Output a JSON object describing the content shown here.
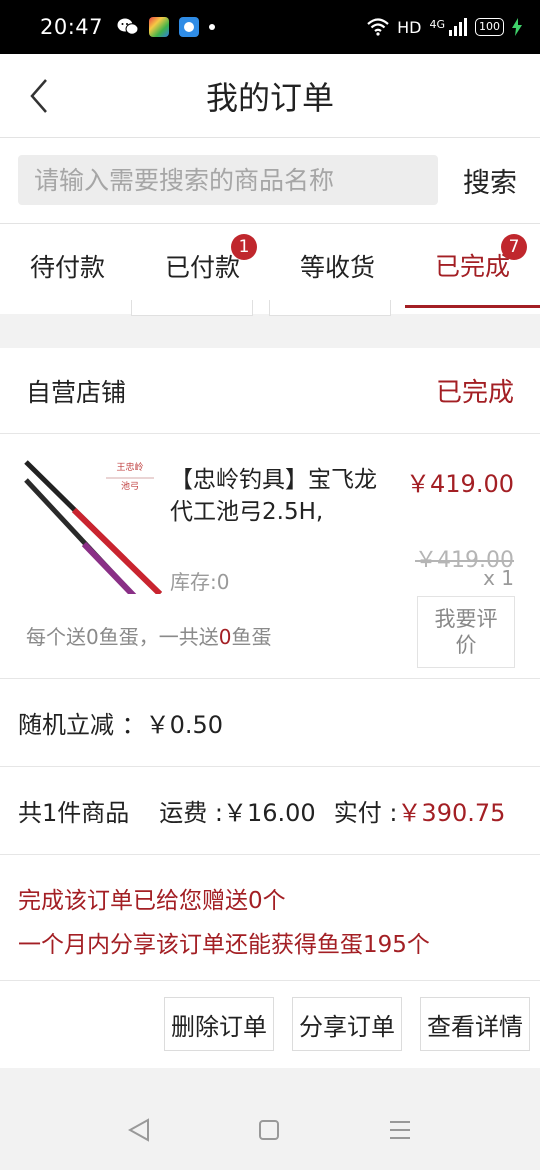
{
  "status_bar": {
    "time": "20:47",
    "network": "HD",
    "signal": "4G",
    "battery": "100"
  },
  "header": {
    "title": "我的订单"
  },
  "search": {
    "placeholder": "请输入需要搜索的商品名称",
    "button_label": "搜索"
  },
  "tabs": [
    {
      "label": "待付款",
      "badge": ""
    },
    {
      "label": "已付款",
      "badge": "1"
    },
    {
      "label": "等收货",
      "badge": ""
    },
    {
      "label": "已完成",
      "badge": "7",
      "active": true
    }
  ],
  "order": {
    "shop_name": "自营店铺",
    "status": "已完成",
    "product": {
      "name": "【忠岭钓具】宝飞龙代工池弓2.5H,",
      "price": "￥419.00",
      "original_price": "￥419.00",
      "stock": "库存:0",
      "quantity": "x 1",
      "thumb_text_1": "王忠岭",
      "thumb_text_2": "池弓"
    },
    "gift_prefix": "每个送0鱼蛋，一共送",
    "gift_count": "0",
    "gift_suffix": "鱼蛋",
    "review_button": "我要评价",
    "discount_label": "随机立减 ：",
    "discount_value": "￥0.50",
    "summary_count": "共1件商品",
    "shipping_label": "运费 :",
    "shipping_value": "￥16.00",
    "paid_label": "实付 :",
    "paid_value": "￥390.75",
    "notice_line_1": "完成该订单已给您赠送0个",
    "notice_line_2": "一个月内分享该订单还能获得鱼蛋195个",
    "actions": [
      "删除订单",
      "分享订单",
      "查看详情"
    ]
  },
  "colors": {
    "accent": "#a31f24",
    "badge": "#c0272d"
  }
}
